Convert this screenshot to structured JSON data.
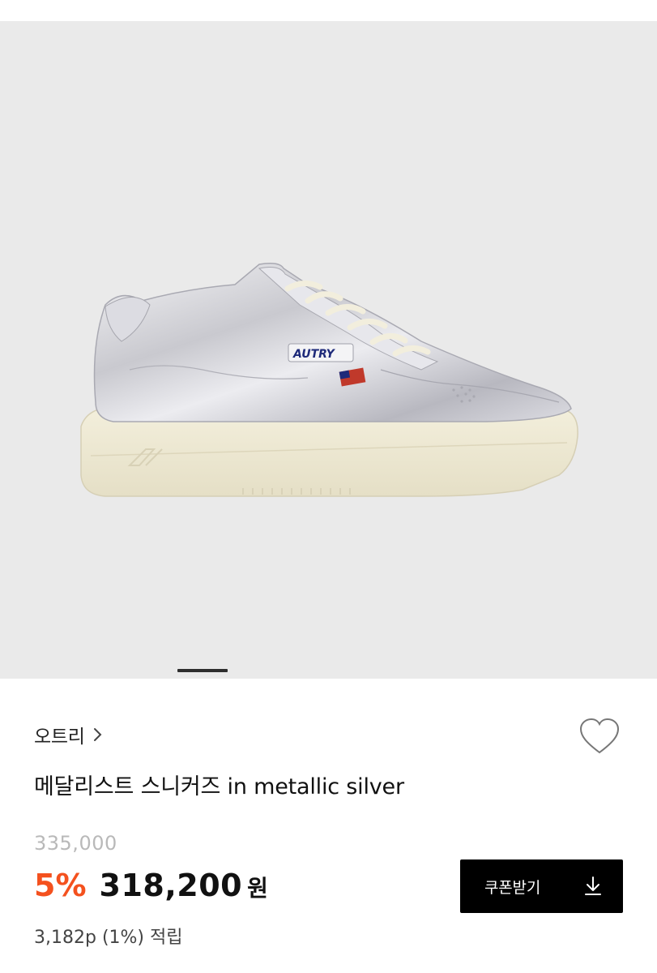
{
  "product": {
    "brand": "오트리",
    "name": "메달리스트 스니커즈 in metallic silver",
    "shoe_logo_text": "AUTRY",
    "original_price": "335,000",
    "discount_rate": "5%",
    "sale_price": "318,200",
    "currency": "원",
    "points": "3,182p (1%) 적립"
  },
  "gallery": {
    "current_slide": 1,
    "background": "#eaeaea"
  },
  "actions": {
    "coupon_label": "쿠폰받기",
    "coupon_icon": "download-icon",
    "wishlist_icon": "heart-outline-icon",
    "brand_link_icon": "chevron-right-icon"
  },
  "colors": {
    "discount": "#f4511e",
    "button_bg": "#000000",
    "original_price": "#b9b9b9"
  }
}
